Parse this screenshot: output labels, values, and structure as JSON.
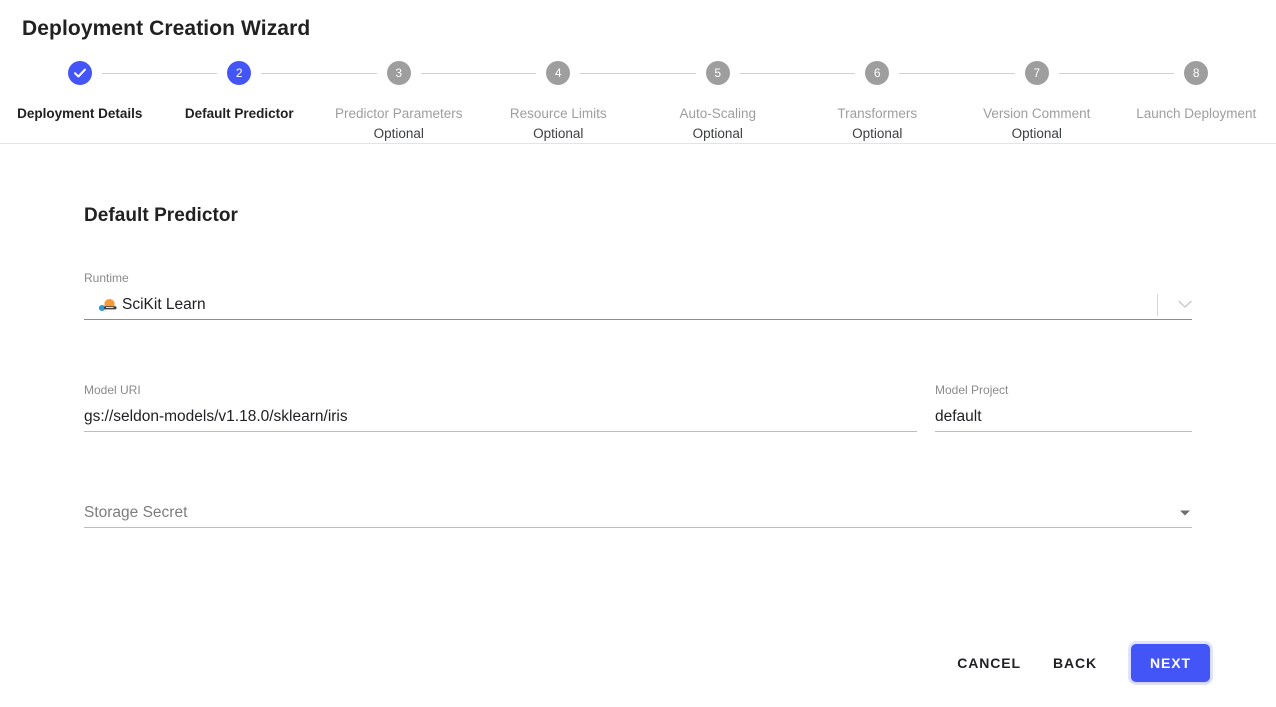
{
  "header": {
    "title": "Deployment Creation Wizard"
  },
  "stepper": {
    "steps": [
      {
        "number": "1",
        "label": "Deployment Details",
        "optional": "",
        "state": "completed"
      },
      {
        "number": "2",
        "label": "Default Predictor",
        "optional": "",
        "state": "active"
      },
      {
        "number": "3",
        "label": "Predictor Parameters",
        "optional": "Optional",
        "state": "upcoming"
      },
      {
        "number": "4",
        "label": "Resource Limits",
        "optional": "Optional",
        "state": "upcoming"
      },
      {
        "number": "5",
        "label": "Auto-Scaling",
        "optional": "Optional",
        "state": "upcoming"
      },
      {
        "number": "6",
        "label": "Transformers",
        "optional": "Optional",
        "state": "upcoming"
      },
      {
        "number": "7",
        "label": "Version Comment",
        "optional": "Optional",
        "state": "upcoming"
      },
      {
        "number": "8",
        "label": "Launch Deployment",
        "optional": "",
        "state": "upcoming"
      }
    ]
  },
  "main": {
    "section_title": "Default Predictor",
    "runtime": {
      "label": "Runtime",
      "value": "SciKit Learn",
      "icon": "scikit-learn-logo",
      "dropdown_icon": "chevron-down-icon"
    },
    "model_uri": {
      "label": "Model URI",
      "value": "gs://seldon-models/v1.18.0/sklearn/iris",
      "placeholder": "Model URI"
    },
    "model_project": {
      "label": "Model Project",
      "value": "default",
      "placeholder": "Model Project"
    },
    "storage_secret": {
      "label": "Storage Secret",
      "value": "",
      "placeholder": "Storage Secret",
      "dropdown_icon": "triangle-down-icon"
    }
  },
  "footer": {
    "cancel_label": "CANCEL",
    "back_label": "BACK",
    "next_label": "NEXT"
  },
  "colors": {
    "accent": "#4355f7",
    "step_inactive": "#9e9e9e",
    "text_primary": "#212121",
    "text_muted": "#8a8a8a"
  }
}
